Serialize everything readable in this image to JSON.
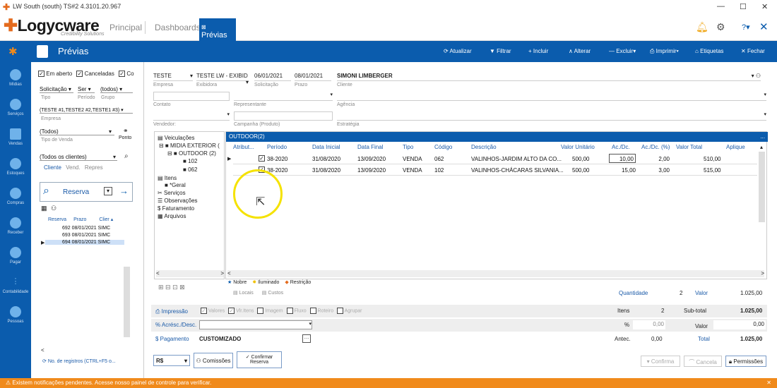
{
  "window": {
    "title": "LW South (south) TS#2 4.3101.20.967"
  },
  "brand": {
    "name": "Logycware",
    "tagline": "Credibility Solutions"
  },
  "nav": {
    "tabs": [
      "Principal",
      "Dashboards",
      "Prévias"
    ]
  },
  "toolbar": {
    "title": "Prévias",
    "buttons": [
      "Atualizar",
      "Filtrar",
      "Incluir",
      "Alterar",
      "Excluir",
      "Imprimir",
      "Etiquetas",
      "Fechar"
    ]
  },
  "sidebar": {
    "items": [
      "Mídias",
      "Serviços",
      "Vendas",
      "Estoques",
      "Compras",
      "Receber",
      "Pagar",
      "Contabilidade",
      "Pessoas"
    ]
  },
  "filters": {
    "checks": [
      "Em aberto",
      "Canceladas",
      "Co"
    ],
    "solicitacao": "Solicitação",
    "ser": "Ser",
    "todos": "(todos)",
    "tipo_lbl": "Tipo",
    "periodo_lbl": "Período",
    "grupo_lbl": "Grupo",
    "empresa_val": "(TESTE #1,TESTE2 #2,TESTE1 #3)",
    "empresa_lbl": "Empresa",
    "tipovenda_val": "(Todos)",
    "tipovenda_lbl": "Tipo de Venda",
    "ponto": "Ponto",
    "clientes_val": "(Todos os clientes)",
    "cliente_tabs": [
      "Cliente",
      "Vend.",
      "Repres"
    ],
    "reserva_lbl": "Reserva",
    "grid_cols": [
      "Reserva",
      "Prazo",
      "Clier"
    ],
    "grid_rows": [
      [
        "692",
        "08/01/2021",
        "SIMC"
      ],
      [
        "693",
        "08/01/2021",
        "SIMC"
      ],
      [
        "694",
        "08/01/2021",
        "SIMC"
      ]
    ],
    "registros": "No. de registros (CTRL+F5 o..."
  },
  "form": {
    "empresa": "TESTE",
    "exibidora": "TESTE LW - EXIBID",
    "solicitacao": "06/01/2021",
    "prazo": "08/01/2021",
    "cliente": "SIMONI LIMBERGER",
    "lbl_empresa": "Empresa",
    "lbl_exibidora": "Exibidora",
    "lbl_solicitacao": "Solicitação",
    "lbl_prazo": "Prazo",
    "lbl_cliente": "Cliente",
    "lbl_contato": "Contato",
    "lbl_representante": "Representante",
    "lbl_agencia": "Agência",
    "lbl_vendedor": "Vendedor:",
    "lbl_campanha": "Campanha (Produto)",
    "lbl_estrategia": "Estratégia"
  },
  "tree": {
    "nodes": [
      "Veiculações",
      "MIDIA EXTERIOR (",
      "OUTDOOR (2)",
      "102",
      "062",
      "Itens",
      "*Geral",
      "Serviços",
      "Observações",
      "Faturamento",
      "Arquivos"
    ]
  },
  "grid": {
    "title": "OUTDOOR(2)",
    "columns": [
      "Atribut...",
      "Período",
      "Data Inicial",
      "Data Final",
      "Tipo",
      "Código",
      "Descrição",
      "Valor Unitário",
      "Ac./Dc.",
      "Ac./Dc. (%)",
      "Valor Total",
      "Aplique"
    ],
    "rows": [
      [
        "38-2020",
        "31/08/2020",
        "13/09/2020",
        "VENDA",
        "062",
        "VALINHOS-JARDIM ALTO DA CO...",
        "500,00",
        "10,00",
        "2,00",
        "510,00"
      ],
      [
        "38-2020",
        "31/08/2020",
        "13/09/2020",
        "VENDA",
        "102",
        "VALINHOS-CHÁCARAS SILVANIA...",
        "500,00",
        "15,00",
        "3,00",
        "515,00"
      ]
    ]
  },
  "legend": {
    "items": [
      "Nobre",
      "Iluminado",
      "Restrição"
    ],
    "tabs": [
      "Locais",
      "Custos"
    ],
    "quantidade_lbl": "Quantidade",
    "quantidade": "2",
    "valor_lbl": "Valor",
    "valor": "1.025,00"
  },
  "totals": {
    "impressao": "Impressão",
    "options": [
      "Valores",
      "Vlr.Itens",
      "Imagem",
      "Fluxo",
      "Roteiro",
      "Agrupar"
    ],
    "itens_lbl": "Itens",
    "itens": "2",
    "subtotal_lbl": "Sub-total",
    "subtotal": "1.025,00",
    "acresc_lbl": "Acrésc./Desc.",
    "pct": "%",
    "pct_val": "0,00",
    "valor_lbl": "Valor",
    "valor_val": "0,00",
    "pagamento_lbl": "Pagamento",
    "pagamento": "CUSTOMIZADO",
    "antec_lbl": "Antec.",
    "antec": "0,00",
    "total_lbl": "Total",
    "total": "1.025,00"
  },
  "footer": {
    "moeda": "R$",
    "comissoes": "Comissões",
    "confirmar": "Confirmar Reserva",
    "confirma": "Confirma",
    "cancela": "Cancela",
    "permissoes": "Permissões"
  },
  "notification": "Existem notificações pendentes. Acesse nosso painel de controle para verificar.",
  "colors": {
    "primary": "#0b5cad",
    "accent": "#f08a1b",
    "highlight": "#f5e200"
  }
}
